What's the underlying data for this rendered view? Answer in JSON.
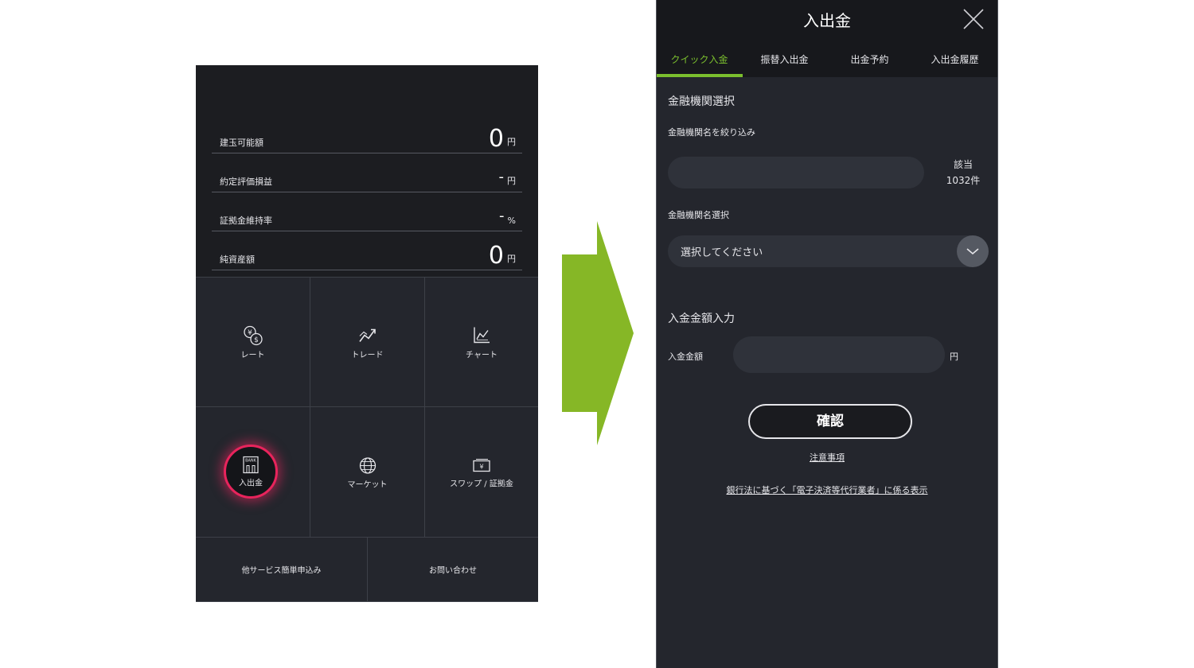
{
  "left": {
    "summary": [
      {
        "label": "建玉可能額",
        "value": "0",
        "unit": "円"
      },
      {
        "label": "約定評価損益",
        "value": "-",
        "unit": "円"
      },
      {
        "label": "証拠金維持率",
        "value": "-",
        "unit": "%"
      },
      {
        "label": "純資産額",
        "value": "0",
        "unit": "円"
      }
    ],
    "tiles": [
      {
        "label": "レート",
        "icon": "yen-dollar-icon"
      },
      {
        "label": "トレード",
        "icon": "trend-chart-icon"
      },
      {
        "label": "チャート",
        "icon": "line-chart-icon"
      },
      {
        "label": "入出金",
        "icon": "bank-icon",
        "bank_text": "BANK"
      },
      {
        "label": "マーケット",
        "icon": "globe-icon"
      },
      {
        "label": "スワップ / 証拠金",
        "icon": "yen-wallet-icon",
        "wallet_text": "¥"
      }
    ],
    "footer": [
      {
        "label": "他サービス簡単申込み"
      },
      {
        "label": "お問い合わせ"
      }
    ],
    "highlight_color": "#e8245c"
  },
  "arrow_color": "#86b726",
  "right": {
    "title": "入出金",
    "tabs": [
      {
        "label": "クイック入金",
        "active": true
      },
      {
        "label": "振替入出金",
        "active": false
      },
      {
        "label": "出金予約",
        "active": false
      },
      {
        "label": "入出金履歴",
        "active": false
      }
    ],
    "accent": "#7bbf2e",
    "bank_section_title": "金融機関選択",
    "filter_label": "金融機関名を絞り込み",
    "filter_value": "",
    "match_label": "該当",
    "match_count": "1032件",
    "bank_select_label": "金融機関名選択",
    "bank_select_value": "選択してください",
    "amount_section_title": "入金金額入力",
    "amount_label": "入金金額",
    "amount_value": "",
    "amount_unit": "円",
    "confirm_label": "確認",
    "notes_link": "注意事項",
    "legal_link": "銀行法に基づく「電子決済等代行業者」に係る表示"
  }
}
